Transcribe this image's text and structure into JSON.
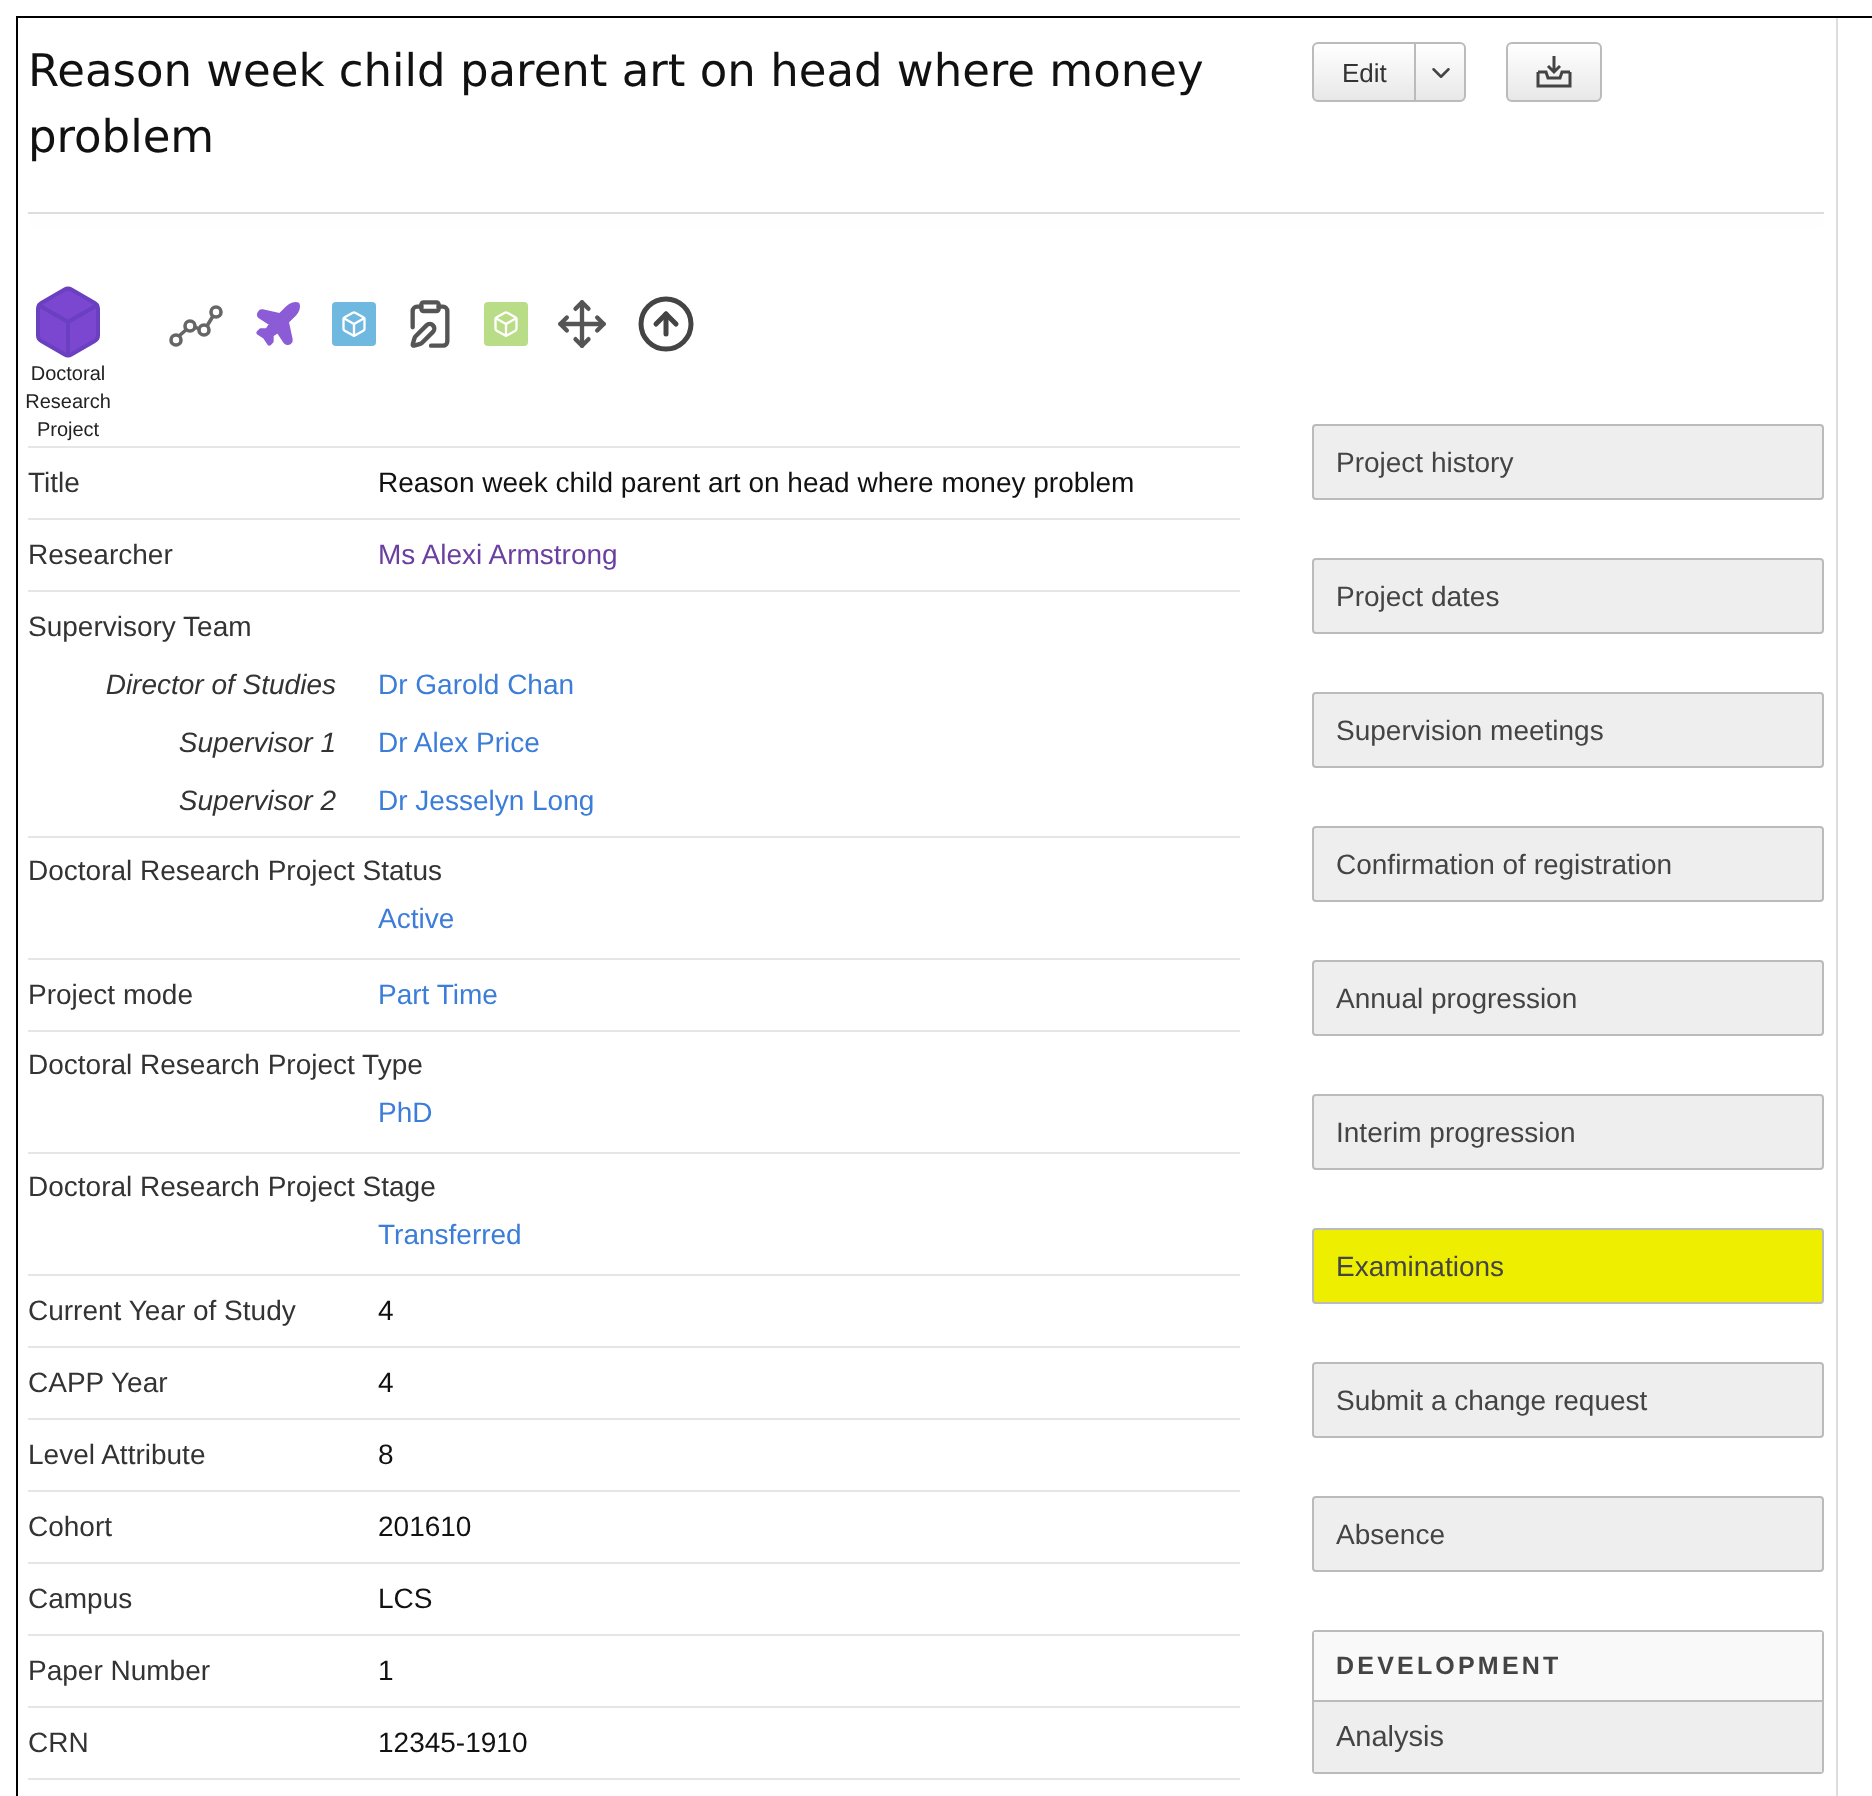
{
  "header": {
    "title": "Reason week child parent art on head where money problem",
    "edit_button": "Edit"
  },
  "record_type": {
    "caption": "Doctoral Research Project"
  },
  "rows": [
    {
      "kind": "text",
      "label": "Title",
      "value": "Reason week child parent art on head where money problem"
    },
    {
      "kind": "visited",
      "label": "Researcher",
      "value": "Ms Alexi Armstrong"
    },
    {
      "kind": "team",
      "label": "Supervisory Team",
      "members": [
        {
          "role": "Director of Studies",
          "name": "Dr Garold Chan"
        },
        {
          "role": "Supervisor 1",
          "name": "Dr Alex Price"
        },
        {
          "role": "Supervisor 2",
          "name": "Dr Jesselyn Long"
        }
      ]
    },
    {
      "kind": "stacked",
      "label": "Doctoral Research Project Status",
      "value": "Active"
    },
    {
      "kind": "link",
      "label": "Project mode",
      "value": "Part Time"
    },
    {
      "kind": "stacked",
      "label": "Doctoral Research Project Type",
      "value": "PhD"
    },
    {
      "kind": "stacked",
      "label": "Doctoral Research Project Stage",
      "value": "Transferred"
    },
    {
      "kind": "text",
      "label": "Current Year of Study",
      "value": "4"
    },
    {
      "kind": "text",
      "label": "CAPP Year",
      "value": "4"
    },
    {
      "kind": "text",
      "label": "Level Attribute",
      "value": "8"
    },
    {
      "kind": "text",
      "label": "Cohort",
      "value": "201610"
    },
    {
      "kind": "text",
      "label": "Campus",
      "value": "LCS"
    },
    {
      "kind": "text",
      "label": "Paper Number",
      "value": "1"
    },
    {
      "kind": "text",
      "label": "CRN",
      "value": "12345-1910"
    }
  ],
  "actions": [
    {
      "label": "Project history",
      "highlighted": false
    },
    {
      "label": "Project dates",
      "highlighted": false
    },
    {
      "label": "Supervision meetings",
      "highlighted": false
    },
    {
      "label": "Confirmation of registration",
      "highlighted": false
    },
    {
      "label": "Annual progression",
      "highlighted": false
    },
    {
      "label": "Interim progression",
      "highlighted": false
    },
    {
      "label": "Examinations",
      "highlighted": true
    },
    {
      "label": "Submit a change request",
      "highlighted": false
    },
    {
      "label": "Absence",
      "highlighted": false
    }
  ],
  "development": {
    "heading": "DEVELOPMENT",
    "items": [
      "Analysis"
    ]
  }
}
